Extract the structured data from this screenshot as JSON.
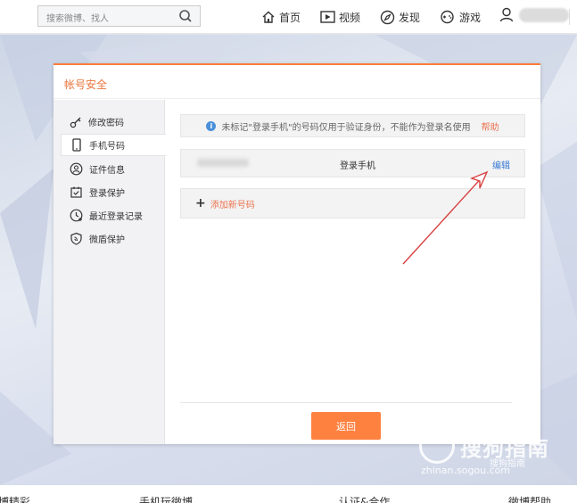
{
  "topbar": {
    "search_placeholder": "搜索微博、找人",
    "nav": {
      "home": "首页",
      "video": "视频",
      "discover": "发现",
      "game": "游戏"
    }
  },
  "panel": {
    "title": "帐号安全",
    "sidebar": [
      {
        "label": "修改密码",
        "icon": "key-icon"
      },
      {
        "label": "手机号码",
        "icon": "phone-icon"
      },
      {
        "label": "证件信息",
        "icon": "id-icon"
      },
      {
        "label": "登录保护",
        "icon": "shield-check-icon"
      },
      {
        "label": "最近登录记录",
        "icon": "history-icon"
      },
      {
        "label": "微盾保护",
        "icon": "shield-icon"
      }
    ],
    "notice": {
      "text": "未标记\"登录手机\"的号码仅用于验证身份，不能作为登录名使用",
      "help": "帮助"
    },
    "phone_row": {
      "label": "登录手机",
      "edit": "编辑"
    },
    "add_row": {
      "label": "添加新号码"
    },
    "back_button": "返回"
  },
  "watermark": {
    "brand": "搜狗指南",
    "url": "zhinan.sogou.com",
    "sub": "搜狗指南"
  },
  "footer": {
    "items": [
      "微博精彩",
      "手机玩微博",
      "认证&合作",
      "微博帮助"
    ]
  },
  "colors": {
    "accent": "#fa7d3c",
    "link": "#3a7bd5",
    "button": "#ff8140"
  }
}
